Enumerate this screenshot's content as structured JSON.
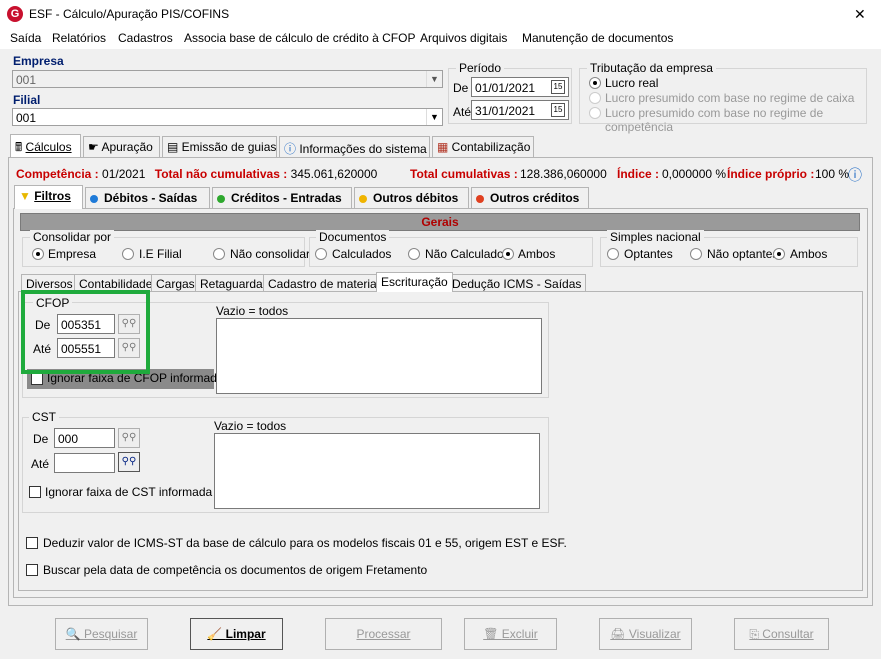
{
  "window": {
    "title": "ESF - Cálculo/Apuração PIS/COFINS",
    "close": "✕"
  },
  "menu": [
    "Saída",
    "Relatórios",
    "Cadastros",
    "Associa base de cálculo de crédito à CFOP",
    "Arquivos digitais",
    "Manutenção de documentos"
  ],
  "empresa": {
    "label": "Empresa",
    "value": "001"
  },
  "filial": {
    "label": "Filial",
    "value": "001"
  },
  "periodo": {
    "label": "Período",
    "de_label": "De",
    "de": "01/01/2021",
    "ate_label": "Até",
    "ate": "31/01/2021"
  },
  "tributacao": {
    "label": "Tributação da empresa",
    "options": [
      "Lucro real",
      "Lucro presumido com base no regime de caixa",
      "Lucro presumido com base no regime de competência"
    ],
    "selected": 0
  },
  "main_tabs": [
    "Cálculos",
    "Apuração",
    "Emissão de guias",
    "Informações do sistema",
    "Contabilização"
  ],
  "summary": {
    "competencia_label": "Competência :",
    "competencia": "01/2021",
    "tnc_label": "Total não cumulativas :",
    "tnc": "345.061,620000",
    "tc_label": "Total cumulativas :",
    "tc": "128.386,060000",
    "indice_label": "Índice :",
    "indice": "0,000000 %",
    "indice_proprio_label": "Índice próprio :",
    "indice_proprio": "100 %"
  },
  "sub_tabs": [
    {
      "label": "Filtros",
      "color": "#e8b800"
    },
    {
      "label": "Débitos - Saídas",
      "color": "#1e7ad8"
    },
    {
      "label": "Créditos - Entradas",
      "color": "#2ea82e"
    },
    {
      "label": "Outros débitos",
      "color": "#f0b400"
    },
    {
      "label": "Outros créditos",
      "color": "#e04020"
    }
  ],
  "gerais": {
    "title": "Gerais",
    "consolidar": {
      "label": "Consolidar por",
      "options": [
        "Empresa",
        "I.E Filial",
        "Não consolidar"
      ],
      "selected": 0
    },
    "documentos": {
      "label": "Documentos",
      "options": [
        "Calculados",
        "Não Calculados",
        "Ambos"
      ],
      "selected": 2
    },
    "simples": {
      "label": "Simples nacional",
      "options": [
        "Optantes",
        "Não optantes",
        "Ambos"
      ],
      "selected": 2
    }
  },
  "filter_tabs": [
    "Diversos",
    "Contabilidade",
    "Cargas",
    "Retaguarda",
    "Cadastro de materiais",
    "Escrituração",
    "Dedução ICMS - Saídas"
  ],
  "cfop": {
    "label": "CFOP",
    "de_label": "De",
    "de": "005351",
    "ate_label": "Até",
    "ate": "005551",
    "vazio": "Vazio = todos",
    "ignorar": "Ignorar faixa de CFOP informada"
  },
  "cst": {
    "label": "CST",
    "de_label": "De",
    "de": "000",
    "ate_label": "Até",
    "ate": "",
    "vazio": "Vazio = todos",
    "ignorar": "Ignorar faixa de CST informada"
  },
  "options": {
    "deduzir": "Deduzir valor de ICMS-ST da base de cálculo para os modelos fiscais 01 e 55, origem EST e ESF.",
    "buscar": "Buscar pela data de competência os documentos de origem Fretamento"
  },
  "buttons": {
    "pesquisar": "Pesquisar",
    "limpar": "Limpar",
    "processar": "Processar",
    "excluir": "Excluir",
    "visualizar": "Visualizar",
    "consultar": "Consultar"
  },
  "colors": {
    "highlight": "#1faa3c",
    "red_label": "#c80000",
    "header_blue": "#001e6e"
  }
}
